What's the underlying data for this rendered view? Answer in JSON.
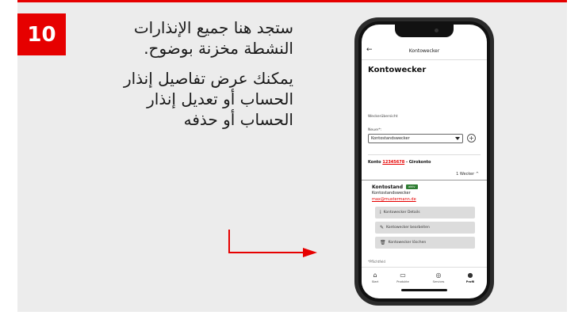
{
  "step_number": "10",
  "description": {
    "para1": "ستجد هنا جميع الإنذارات النشطة مخزنة بوضوح.",
    "para2": "يمكنك عرض تفاصيل إنذار الحساب أو تعديل إنذار الحساب أو حذفه"
  },
  "colors": {
    "brand_red": "#e60000",
    "active_green": "#2e7d32",
    "panel_bg": "#ececec"
  },
  "app": {
    "back_icon": "back-arrow-icon",
    "header_title": "Kontowecker",
    "page_title": "Kontowecker",
    "section_label": "Weckerübersicht",
    "new_field_label": "Neuer*:",
    "new_field_value": "Kontostandswecker",
    "account": {
      "prefix": "Konto ",
      "number": "12345678",
      "suffix": " - Girokonto"
    },
    "alarm_count": "1 Wecker",
    "alarm": {
      "name": "Kontostand",
      "status": "aktiv",
      "type": "Kontostandswecker",
      "email": "max@mustermann.de"
    },
    "actions": {
      "details": "Kontowecker Details",
      "edit": "Kontowecker bearbeiten",
      "delete": "Kontowecker löschen"
    },
    "footnote": "*Pflichtfeld",
    "tabs": [
      {
        "label": "Start",
        "icon": "home-icon"
      },
      {
        "label": "Produkte",
        "icon": "box-icon"
      },
      {
        "label": "Services",
        "icon": "services-icon"
      },
      {
        "label": "Profil",
        "icon": "user-icon"
      }
    ]
  }
}
